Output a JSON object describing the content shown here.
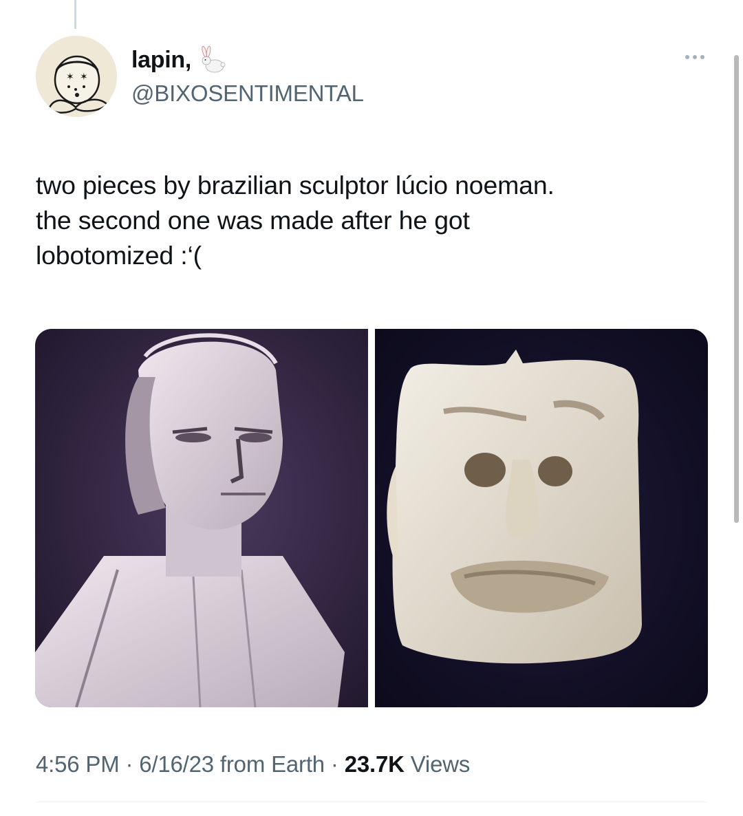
{
  "tweet": {
    "author": {
      "display_name": "lapin,",
      "handle": "@BIXOSENTIMENTAL",
      "avatar_icon": "clown-avatar-icon",
      "name_emoji": "rabbit-icon"
    },
    "text": "two pieces by brazilian sculptor lúcio noeman.\nthe second one was made after he got\nlobotomized :‘(",
    "media": [
      {
        "icon": "sculpture-bust-image"
      },
      {
        "icon": "sculpture-face-image"
      }
    ],
    "meta": {
      "time": "4:56 PM",
      "separator": " · ",
      "date": "6/16/23",
      "source": " from Earth",
      "views_count": "23.7K",
      "views_label": " Views"
    }
  },
  "colors": {
    "text_primary": "#0f1419",
    "text_secondary": "#536471",
    "divider": "#eff3f4"
  }
}
